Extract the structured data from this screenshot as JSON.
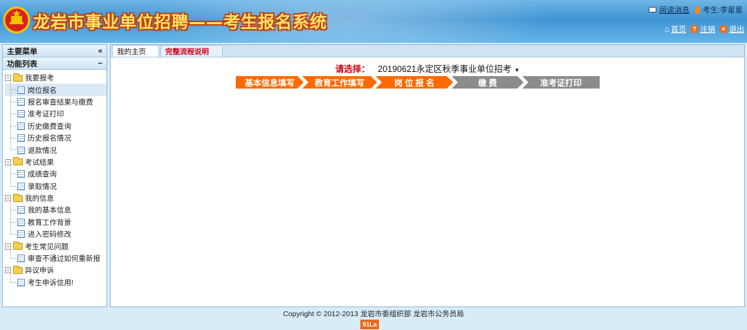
{
  "header": {
    "title": "龙岩市事业单位招聘——考生报名系统",
    "read_msg": "阅读消息",
    "user": "考生:李星星",
    "home": "首页",
    "logout": "注销",
    "exit": "退出"
  },
  "sidebar": {
    "main_menu": "主要菜单",
    "collapse": "«",
    "func_list": "功能列表",
    "func_toggle": "−",
    "groups": [
      {
        "label": "我要报考",
        "items": [
          "岗位报名",
          "报名审查结果与缴费",
          "准考证打印",
          "历史缴费查询",
          "历史报名情况",
          "退款情况"
        ]
      },
      {
        "label": "考试结果",
        "items": [
          "成绩查询",
          "录取情况"
        ]
      },
      {
        "label": "我的信息",
        "items": [
          "我的基本信息",
          "教育工作背景",
          "进入密码修改"
        ]
      },
      {
        "label": "考生常见问题",
        "items": [
          "审查不通过如何重新报"
        ]
      },
      {
        "label": "异议申诉",
        "items": [
          "考生申诉信用!"
        ]
      }
    ]
  },
  "main": {
    "tabs": [
      "我的主页",
      "完整流程说明"
    ],
    "select_label": "请选择：",
    "select_value": "20190621永定区秋季事业单位招考",
    "steps": [
      "基本信息填写",
      "教育工作填写",
      "岗 位 报 名",
      "缴 费",
      "准考证打印"
    ],
    "colors": {
      "active_step": "#ff6a00",
      "inactive_step": "#8c8c8c",
      "accent_red": "#d0021b"
    }
  },
  "footer": {
    "copyright": "Copyright © 2012-2013 龙岩市委组织部 龙岩市公务员局",
    "badge": "51La"
  }
}
